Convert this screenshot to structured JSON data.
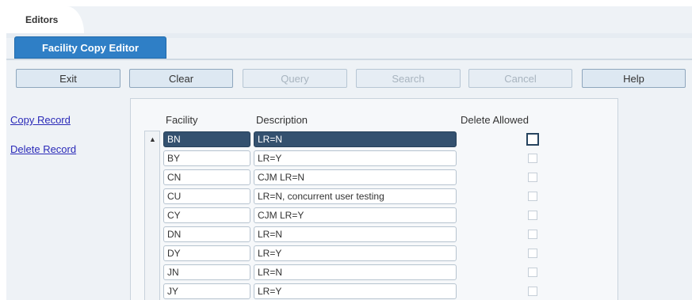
{
  "tabs": {
    "top": "Editors",
    "editor": "Facility Copy Editor"
  },
  "toolbar": {
    "exit": "Exit",
    "clear": "Clear",
    "query": "Query",
    "search": "Search",
    "cancel": "Cancel",
    "help": "Help"
  },
  "actions": {
    "copy": "Copy Record",
    "delete": "Delete Record"
  },
  "table": {
    "headers": {
      "facility": "Facility",
      "description": "Description",
      "delete_allowed": "Delete Allowed"
    },
    "rows": [
      {
        "facility": "BN",
        "description": "LR=N",
        "delete_allowed": false
      },
      {
        "facility": "BY",
        "description": "LR=Y",
        "delete_allowed": false
      },
      {
        "facility": "CN",
        "description": "CJM LR=N",
        "delete_allowed": false
      },
      {
        "facility": "CU",
        "description": "LR=N, concurrent user testing",
        "delete_allowed": false
      },
      {
        "facility": "CY",
        "description": "CJM LR=Y",
        "delete_allowed": false
      },
      {
        "facility": "DN",
        "description": "LR=N",
        "delete_allowed": false
      },
      {
        "facility": "DY",
        "description": "LR=Y",
        "delete_allowed": false
      },
      {
        "facility": "JN",
        "description": "LR=N",
        "delete_allowed": false
      },
      {
        "facility": "JY",
        "description": "LR=Y",
        "delete_allowed": false
      }
    ],
    "selected_row": 0
  },
  "icons": {
    "scroll_up": "scroll-up-arrow-icon"
  },
  "colors": {
    "tab_active": "#2f7fc6",
    "selection": "#34516f",
    "link": "#2a2ab8"
  }
}
